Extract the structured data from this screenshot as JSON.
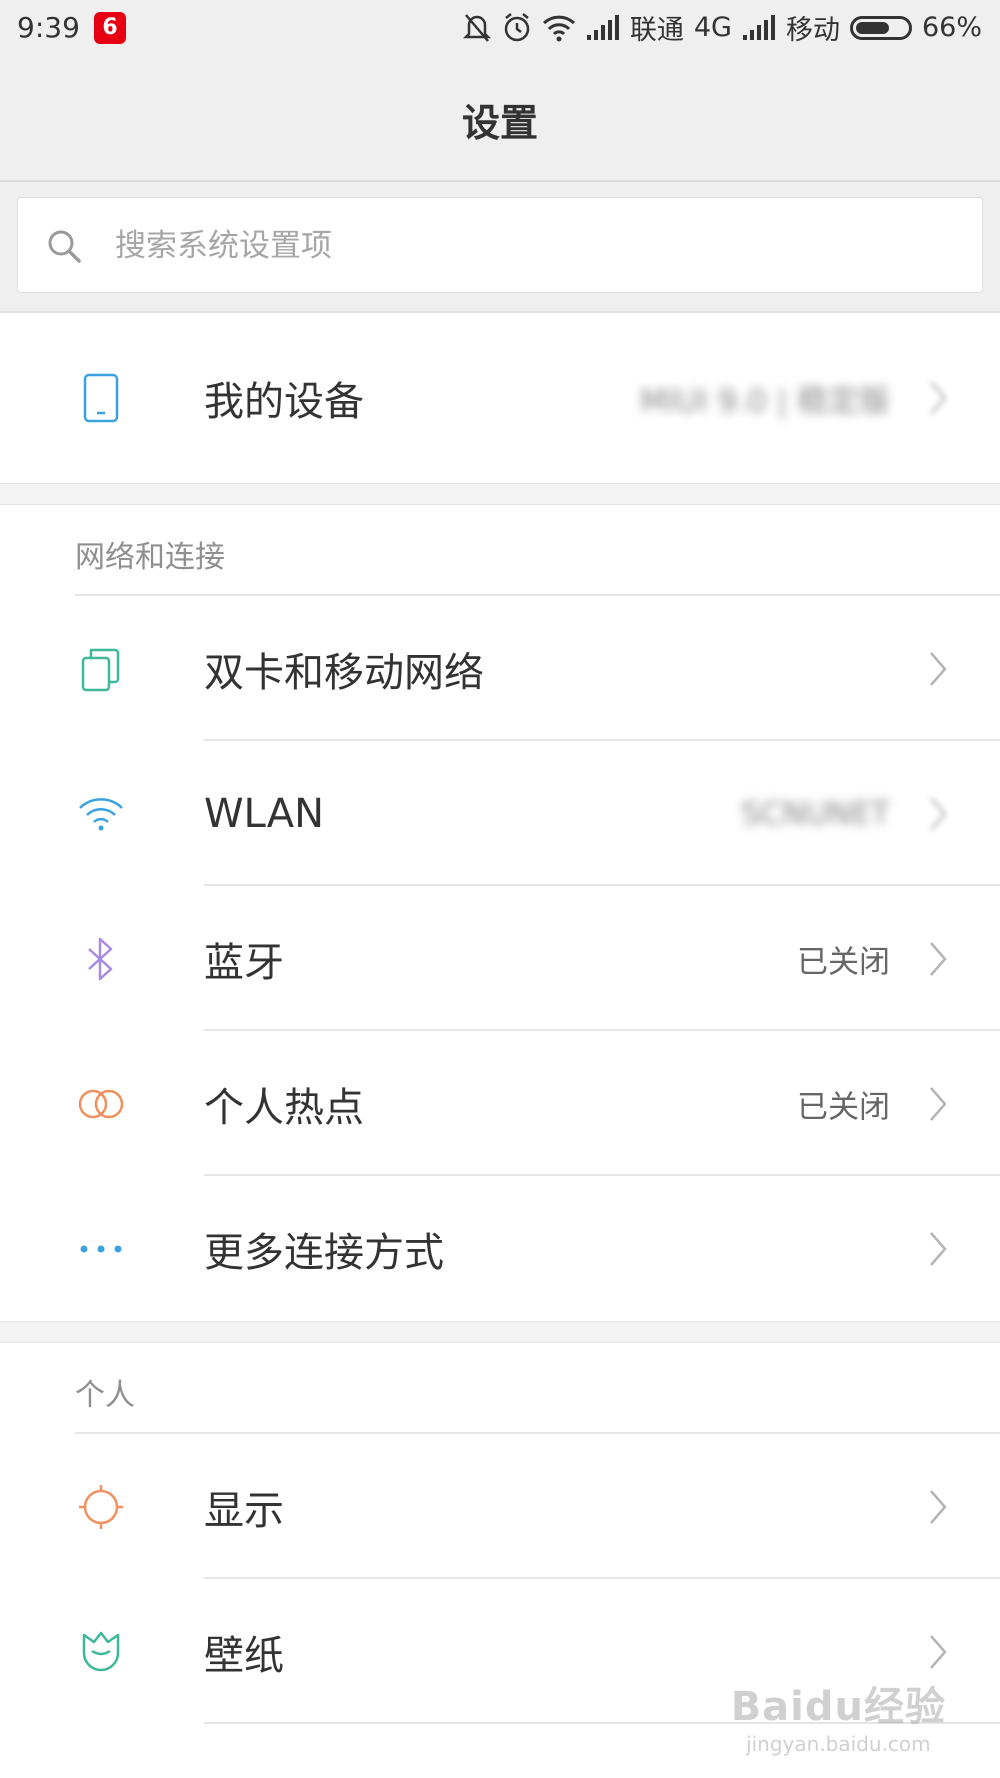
{
  "status_bar": {
    "time": "9:39",
    "app_badge": "6",
    "carrier1": "联通",
    "network": "4G",
    "carrier2": "移动",
    "battery": "66%",
    "battery_level": 0.66
  },
  "header": {
    "title": "设置"
  },
  "search": {
    "placeholder": "搜索系统设置项"
  },
  "device": {
    "label": "我的设备",
    "value": "MIUI 9.0 | 稳定版"
  },
  "sections": {
    "network": {
      "title": "网络和连接",
      "items": [
        {
          "label": "双卡和移动网络",
          "value": "",
          "icon": "sim-cards-icon"
        },
        {
          "label": "WLAN",
          "value": "SCNUNET",
          "icon": "wifi-icon"
        },
        {
          "label": "蓝牙",
          "value": "已关闭",
          "icon": "bluetooth-icon"
        },
        {
          "label": "个人热点",
          "value": "已关闭",
          "icon": "hotspot-icon"
        },
        {
          "label": "更多连接方式",
          "value": "",
          "icon": "more-dots-icon"
        }
      ]
    },
    "personal": {
      "title": "个人",
      "items": [
        {
          "label": "显示",
          "value": "",
          "icon": "display-sun-icon"
        },
        {
          "label": "壁纸",
          "value": "",
          "icon": "wallpaper-icon"
        }
      ]
    }
  },
  "watermark": {
    "line1": "Baidu经验",
    "line2": "jingyan.baidu.com"
  },
  "colors": {
    "header_bg": "#efefef",
    "wifi": "#3aa2e0",
    "bluetooth": "#a78ae3",
    "hotspot": "#f0925f",
    "display": "#f0925f",
    "wallpaper": "#3db89a",
    "sim": "#3db89a"
  }
}
